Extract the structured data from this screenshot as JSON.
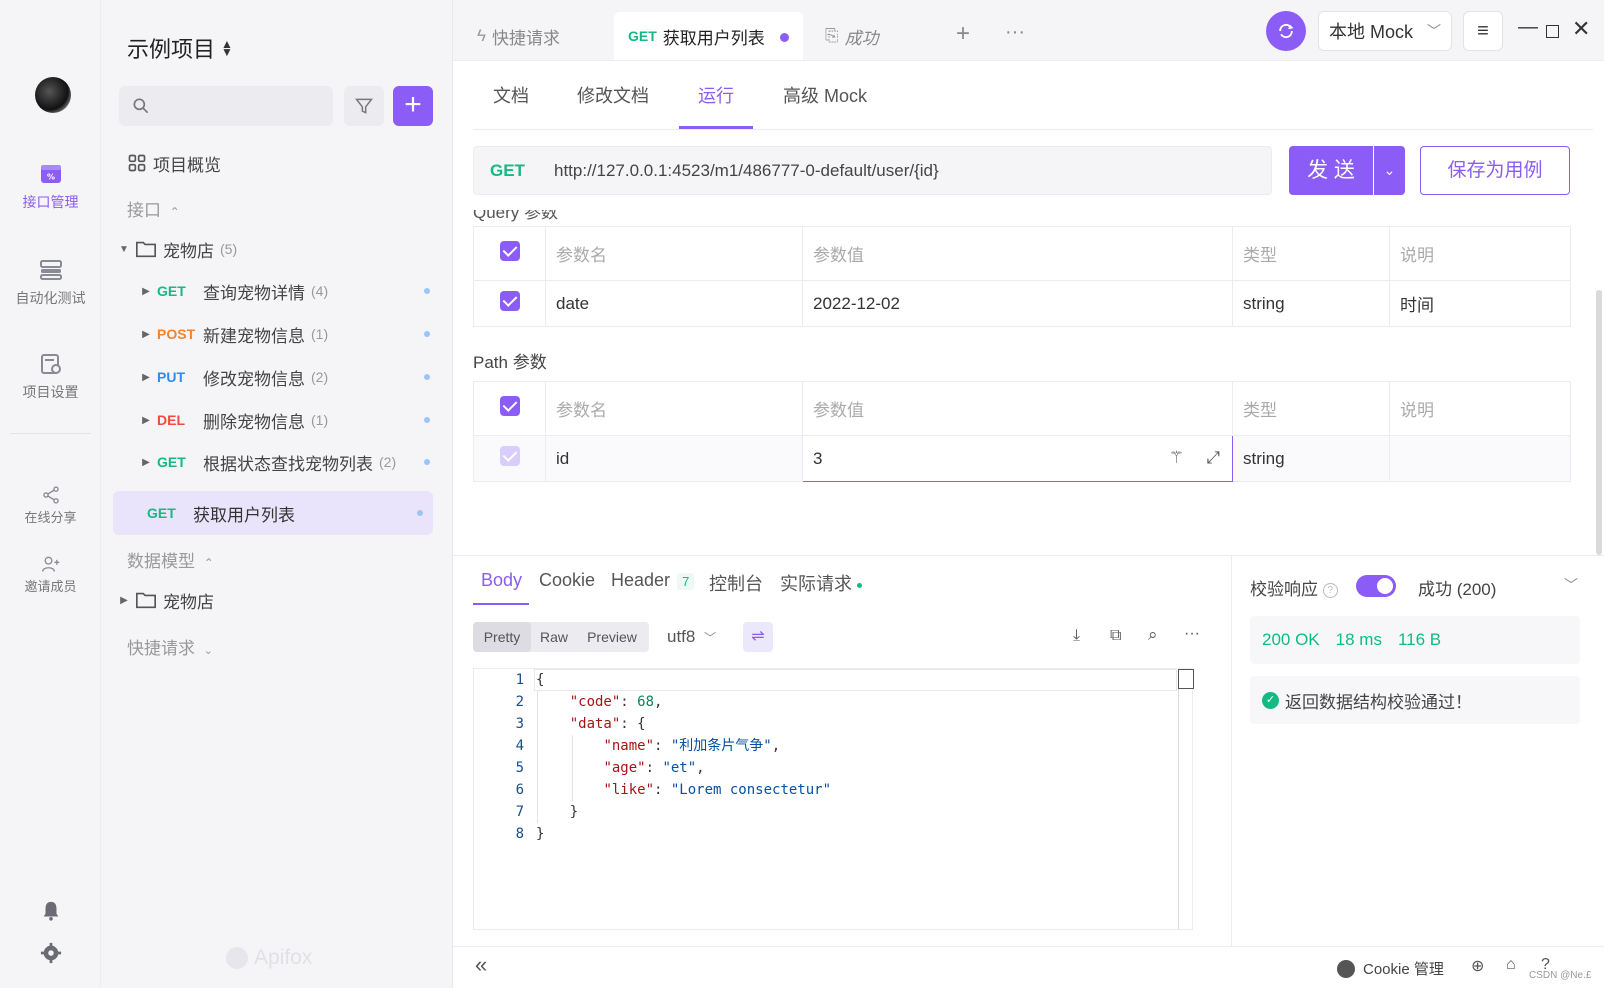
{
  "brand_color": "#8b5cf6",
  "rail": {
    "items": [
      {
        "label": "接口管理",
        "icon": "api-icon"
      },
      {
        "label": "自动化测试",
        "icon": "automation-icon"
      },
      {
        "label": "项目设置",
        "icon": "settings-doc-icon"
      },
      {
        "label": "在线分享",
        "icon": "share-icon"
      },
      {
        "label": "邀请成员",
        "icon": "add-user-icon"
      }
    ]
  },
  "sidebar": {
    "project_name": "示例项目",
    "overview": "项目概览",
    "section_api": "接口",
    "folder": {
      "name": "宠物店",
      "count": "(5)"
    },
    "endpoints": [
      {
        "method": "GET",
        "name": "查询宠物详情",
        "count": "(4)"
      },
      {
        "method": "POST",
        "name": "新建宠物信息",
        "count": "(1)"
      },
      {
        "method": "PUT",
        "name": "修改宠物信息",
        "count": "(2)"
      },
      {
        "method": "DEL",
        "name": "删除宠物信息",
        "count": "(1)"
      },
      {
        "method": "GET",
        "name": "根据状态查找宠物列表",
        "count": "(2)"
      }
    ],
    "selected": {
      "method": "GET",
      "name": "获取用户列表"
    },
    "section_models": "数据模型",
    "model_folder": "宠物店",
    "section_quick": "快捷请求",
    "watermark": "Apifox"
  },
  "topbar": {
    "tabs": [
      {
        "label": "快捷请求"
      },
      {
        "method": "GET",
        "label": "获取用户列表"
      },
      {
        "label": "成功"
      }
    ],
    "env": "本地 Mock"
  },
  "subtabs": [
    "文档",
    "修改文档",
    "运行",
    "高级 Mock"
  ],
  "request": {
    "method": "GET",
    "url": "http://127.0.0.1:4523/m1/486777-0-default/user/{id}",
    "send": "发 送",
    "save": "保存为用例"
  },
  "query_params": {
    "partial_title": "Query 参数",
    "headers": [
      "参数名",
      "参数值",
      "类型",
      "说明"
    ],
    "rows": [
      {
        "name": "date",
        "value": "2022-12-02",
        "type": "string",
        "desc": "时间"
      }
    ]
  },
  "path_params": {
    "title": "Path 参数",
    "headers": [
      "参数名",
      "参数值",
      "类型",
      "说明"
    ],
    "rows": [
      {
        "name": "id",
        "value": "3",
        "type": "string",
        "desc": ""
      }
    ]
  },
  "response": {
    "tabs": [
      "Body",
      "Cookie",
      "Header",
      "控制台",
      "实际请求"
    ],
    "header_count": "7",
    "view_modes": [
      "Pretty",
      "Raw",
      "Preview"
    ],
    "encoding": "utf8",
    "line_numbers": [
      "1",
      "2",
      "3",
      "4",
      "5",
      "6",
      "7",
      "8"
    ],
    "json": {
      "code_key": "\"code\"",
      "code_val": "68",
      "data_key": "\"data\"",
      "name_key": "\"name\"",
      "name_val": "\"利加条片气争\"",
      "age_key": "\"age\"",
      "age_val": "\"et\"",
      "like_key": "\"like\"",
      "like_val": "\"Lorem consectetur\""
    }
  },
  "validation": {
    "label": "校验响应",
    "status_select": "成功 (200)",
    "status": "200 OK",
    "time": "18 ms",
    "size": "116 B",
    "message": "返回数据结构校验通过！"
  },
  "footer": {
    "cookie": "Cookie 管理",
    "watermark": "CSDN @Ne.£"
  }
}
